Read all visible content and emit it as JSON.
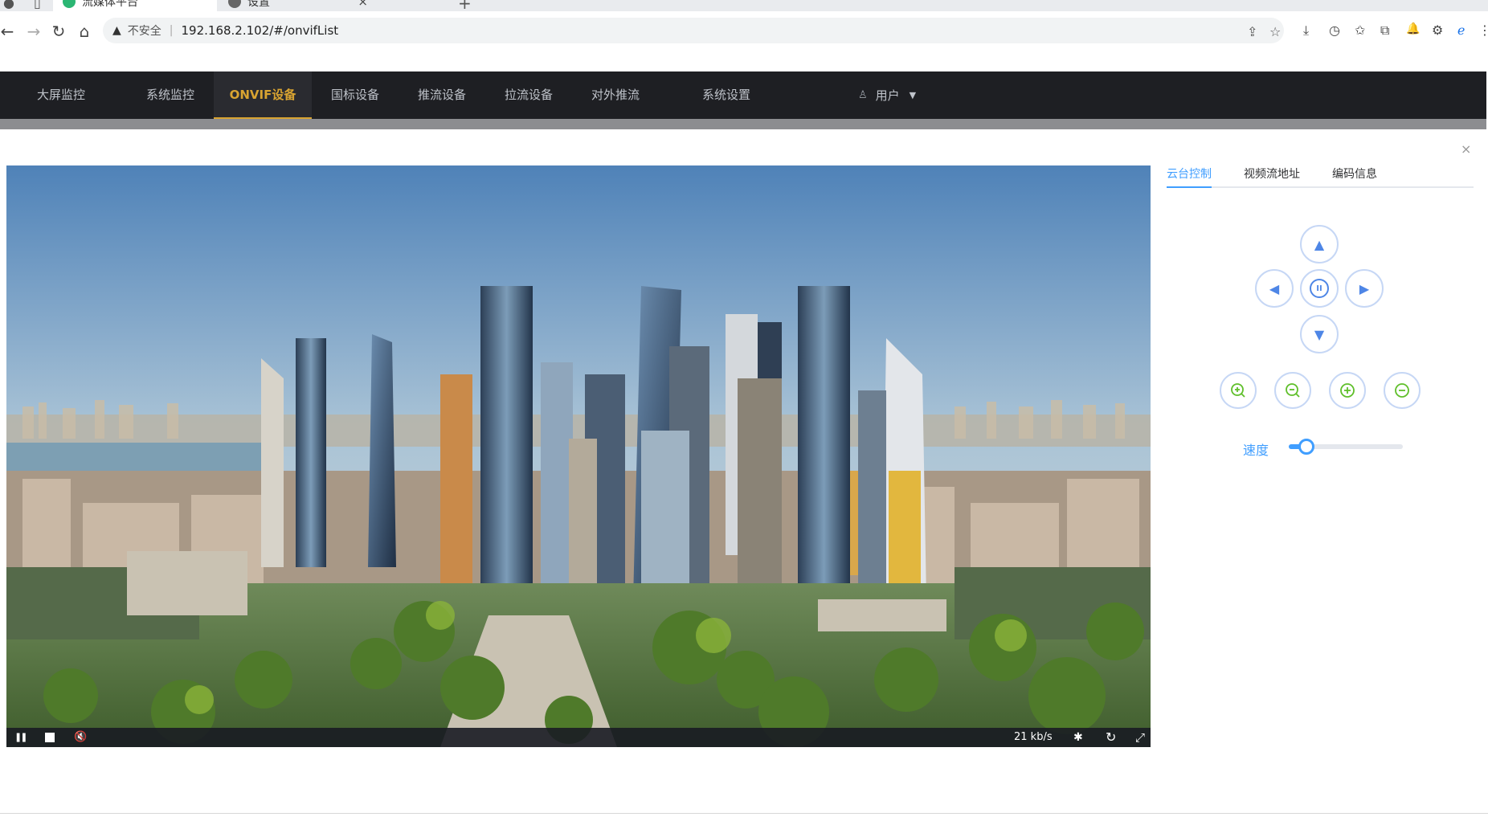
{
  "browser": {
    "tabs": [
      {
        "title": "流媒体平台",
        "active": true
      },
      {
        "title": "设置",
        "active": false
      }
    ],
    "security_text": "不安全",
    "url": "192.168.2.102/#/onvifList",
    "icons": {
      "back": "←",
      "forward": "→",
      "reload": "↻",
      "home": "⌂",
      "warning": "▲",
      "share": "⇪",
      "star": "☆",
      "download": "⤓",
      "history": "◷",
      "favorites": "✩",
      "collections": "⧉",
      "notifications": "🔔",
      "extensions": "⚙",
      "edge": "ℯ",
      "more": "⋮",
      "new_tab": "+",
      "tab_close": "×"
    }
  },
  "nav": {
    "items": [
      {
        "label": "大屏监控",
        "active": false
      },
      {
        "label": "系统监控",
        "active": false
      },
      {
        "label": "ONVIF设备",
        "active": true
      },
      {
        "label": "国标设备",
        "active": false
      },
      {
        "label": "推流设备",
        "active": false
      },
      {
        "label": "拉流设备",
        "active": false
      },
      {
        "label": "对外推流",
        "active": false
      },
      {
        "label": "系统设置",
        "active": false
      }
    ],
    "user_label": "用户",
    "accent_color": "#d9a431"
  },
  "player": {
    "bitrate": "21 kb/s",
    "controls": {
      "pause": "❚❚",
      "mute": "🔇",
      "settings": "✱",
      "refresh": "↻",
      "fullscreen": "⤢"
    }
  },
  "panel": {
    "close": "×",
    "tabs": [
      {
        "label": "云台控制",
        "active": true
      },
      {
        "label": "视频流地址",
        "active": false
      },
      {
        "label": "编码信息",
        "active": false
      }
    ],
    "ptz": {
      "up": "▲",
      "down": "▼",
      "left": "◀",
      "right": "▶",
      "stop": "II"
    },
    "zoom_buttons": [
      "zoom-in",
      "zoom-out",
      "focus-plus",
      "focus-minus"
    ],
    "speed_label": "速度",
    "speed_value": 0.1,
    "accent_color": "#409eff"
  }
}
